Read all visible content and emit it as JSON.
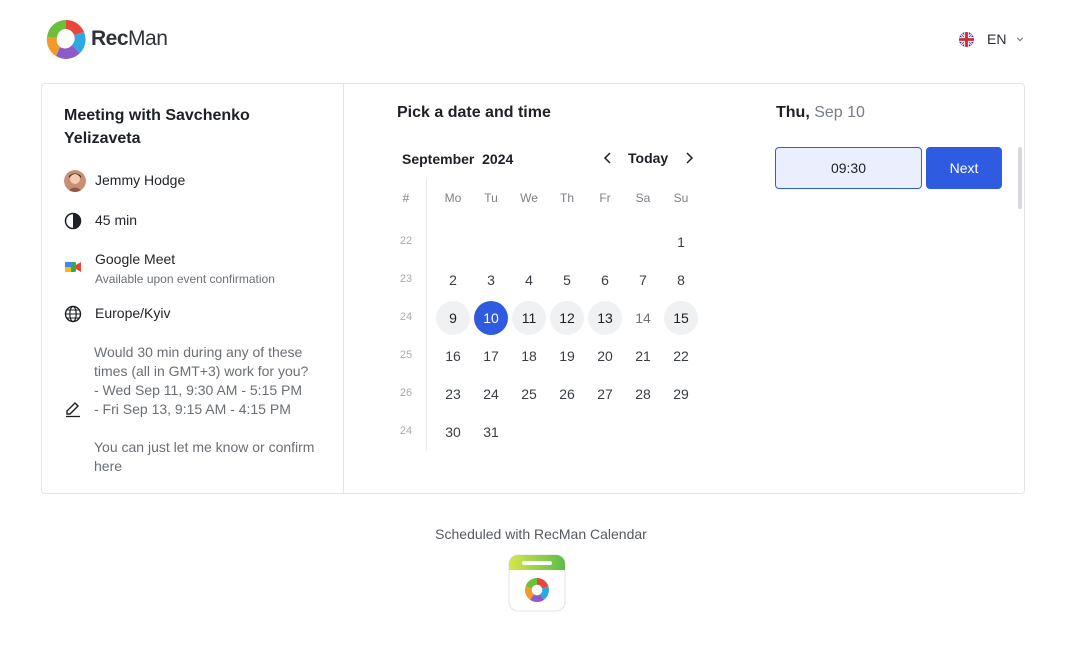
{
  "header": {
    "brand_bold": "Rec",
    "brand_light": "Man",
    "language": "EN",
    "icons": {
      "logo": "recman-logo",
      "flag": "uk-flag-icon",
      "chevron": "chevron-down-icon"
    }
  },
  "event": {
    "title": "Meeting with Savchenko Yelizaveta",
    "host": "Jemmy Hodge",
    "duration": "45 min",
    "location": "Google Meet",
    "location_note": "Available upon event confirmation",
    "timezone": "Europe/Kyiv",
    "description": "Would 30 min during any of these times (all in GMT+3) work for you?\n- Wed Sep 11, 9:30 AM - 5:15 PM\n- Fri Sep 13, 9:15 AM - 4:15 PM\n\nYou can just let me know or confirm here"
  },
  "calendar": {
    "heading": "Pick a date and time",
    "month": "September",
    "year": "2024",
    "today_label": "Today",
    "week_header": "#",
    "weekdays": [
      "Mo",
      "Tu",
      "We",
      "Th",
      "Fr",
      "Sa",
      "Su"
    ],
    "weeks": [
      {
        "num": "22",
        "days": [
          "",
          "",
          "",
          "",
          "",
          "",
          "1"
        ]
      },
      {
        "num": "23",
        "days": [
          "2",
          "3",
          "4",
          "5",
          "6",
          "7",
          "8"
        ]
      },
      {
        "num": "24",
        "days": [
          "9",
          "10",
          "11",
          "12",
          "13",
          "14",
          "15"
        ]
      },
      {
        "num": "25",
        "days": [
          "16",
          "17",
          "18",
          "19",
          "20",
          "21",
          "22"
        ]
      },
      {
        "num": "26",
        "days": [
          "23",
          "24",
          "25",
          "26",
          "27",
          "28",
          "29"
        ]
      },
      {
        "num": "24",
        "days": [
          "30",
          "31",
          "",
          "",
          "",
          "",
          ""
        ]
      }
    ],
    "available_days": [
      "9",
      "11",
      "12",
      "13",
      "15"
    ],
    "selected_day": "10"
  },
  "selection": {
    "weekday": "Thu,",
    "date": "Sep 10",
    "time_slots": [
      "09:30"
    ],
    "next_label": "Next"
  },
  "footer": {
    "text": "Scheduled with RecMan Calendar"
  },
  "colors": {
    "accent": "#2f5be0",
    "slot_bg": "#ebeffd",
    "available_bg": "#f0f1f3"
  }
}
